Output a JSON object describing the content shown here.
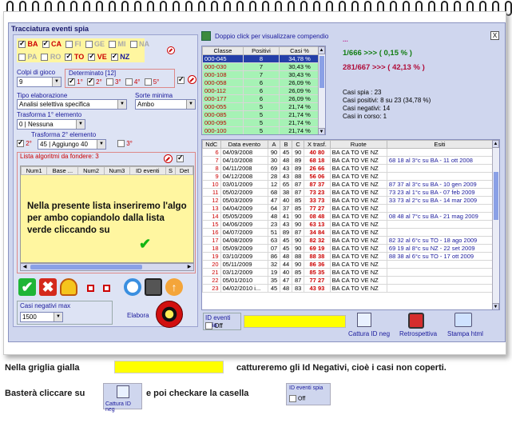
{
  "window_title": "Tracciatura eventi spia",
  "wheels_top": [
    {
      "label": "BA",
      "checked": true,
      "color": "#c00"
    },
    {
      "label": "CA",
      "checked": true,
      "color": "#c00"
    },
    {
      "label": "FI",
      "checked": false,
      "color": "#aaa"
    },
    {
      "label": "GE",
      "checked": false,
      "color": "#aaa"
    },
    {
      "label": "MI",
      "checked": false,
      "color": "#aaa"
    },
    {
      "label": "NA",
      "checked": false,
      "color": "#aaa"
    }
  ],
  "wheels_bottom": [
    {
      "label": "PA",
      "checked": false,
      "color": "#aaa"
    },
    {
      "label": "RO",
      "checked": false,
      "color": "#aaa"
    },
    {
      "label": "TO",
      "checked": true,
      "color": "#c00"
    },
    {
      "label": "VE",
      "checked": true,
      "color": "#c00"
    },
    {
      "label": "NZ",
      "checked": true,
      "color": "#1a1a9c"
    }
  ],
  "colpi_label": "Colpi di gioco",
  "colpi_value": "9",
  "determinato_label": "Determinato [12]",
  "determinato": [
    {
      "label": "1°",
      "checked": true
    },
    {
      "label": "2°",
      "checked": true
    },
    {
      "label": "3°",
      "checked": false
    },
    {
      "label": "4°",
      "checked": false
    },
    {
      "label": "5°",
      "checked": false
    }
  ],
  "tipo_label": "Tipo elaborazione",
  "tipo_value": "Analisi selettiva specifica",
  "sorte_label": "Sorte minima",
  "sorte_value": "Ambo",
  "trasforma1_label": "Trasforma 1° elemento",
  "trasforma1_value": "0 | Nessuna",
  "trasforma2_label": "Trasforma 2° elemento",
  "trasforma2_pos": "2°",
  "trasforma2_value": "45 | Aggiungo 40",
  "trasforma2_pos3": "3°",
  "lista_label": "Lista algoritmi da fondere: 3",
  "lista_columns": [
    "Num1",
    "Base ...",
    "Num2",
    "Num3",
    "ID eventi",
    "S",
    "Det"
  ],
  "overlay_text": "Nella presente lista inseriremo l'algo per ambo copiandolo dalla lista verde cliccando su",
  "casi_neg_label": "Casi negativi max",
  "casi_neg_value": "1500",
  "elabora_label": "Elabora",
  "green_hint": "Doppio click per visualizzare compendio",
  "green_columns": [
    "Classe",
    "Positivi",
    "Casi %"
  ],
  "green_rows": [
    [
      "000-045",
      "8",
      "34,78 %"
    ],
    [
      "000-030",
      "7",
      "30,43 %"
    ],
    [
      "000-108",
      "7",
      "30,43 %"
    ],
    [
      "000-058",
      "6",
      "26,09 %"
    ],
    [
      "000-112",
      "6",
      "26,09 %"
    ],
    [
      "000-177",
      "6",
      "26,09 %"
    ],
    [
      "000-055",
      "5",
      "21,74 %"
    ],
    [
      "000-085",
      "5",
      "21,74 %"
    ],
    [
      "000-095",
      "5",
      "21,74 %"
    ],
    [
      "000-100",
      "5",
      "21,74 %"
    ]
  ],
  "stats": {
    "dots": "...",
    "line1": "1/666 >>> ( 0,15 % )",
    "line2": "281/667 >>> ( 42,13 % )",
    "casi_spia": "Casi spia : 23",
    "casi_positivi": "Casi positivi: 8 su 23 (34,78 %)",
    "casi_negativi": "Casi negativi: 14",
    "casi_in_corso": "Casi in corso: 1"
  },
  "close_label": "X",
  "events_columns": [
    "NdC",
    "Data evento",
    "A",
    "B",
    "C",
    "X trasf.",
    "Ruote",
    "Esiti"
  ],
  "events_rows": [
    [
      "6",
      "04/09/2008",
      "90",
      "45",
      "90",
      "40 80",
      "BA CA TO VE NZ",
      ""
    ],
    [
      "7",
      "04/10/2008",
      "30",
      "48",
      "89",
      "68 18",
      "BA CA TO VE NZ",
      "68 18 al 3°c su BA - 11 ott 2008"
    ],
    [
      "8",
      "04/11/2008",
      "69",
      "43",
      "89",
      "26 66",
      "BA CA TO VE NZ",
      ""
    ],
    [
      "9",
      "04/12/2008",
      "28",
      "43",
      "88",
      "56 06",
      "BA CA TO VE NZ",
      ""
    ],
    [
      "10",
      "03/01/2009",
      "12",
      "65",
      "87",
      "87 37",
      "BA CA TO VE NZ",
      "87 37 al 3°c su BA - 10 gen 2009"
    ],
    [
      "11",
      "05/02/2009",
      "68",
      "38",
      "87",
      "73 23",
      "BA CA TO VE NZ",
      "73 23 al 1°c su BA - 07 feb 2009"
    ],
    [
      "12",
      "05/03/2009",
      "47",
      "40",
      "85",
      "33 73",
      "BA CA TO VE NZ",
      "33 73 al 2°c su BA - 14 mar 2009"
    ],
    [
      "13",
      "04/04/2009",
      "64",
      "37",
      "85",
      "77 27",
      "BA CA TO VE NZ",
      ""
    ],
    [
      "14",
      "05/05/2009",
      "48",
      "41",
      "90",
      "08 48",
      "BA CA TO VE NZ",
      "08 48 al 7°c su BA - 21 mag 2009"
    ],
    [
      "15",
      "04/06/2009",
      "23",
      "43",
      "90",
      "63 13",
      "BA CA TO VE NZ",
      ""
    ],
    [
      "16",
      "04/07/2009",
      "51",
      "89",
      "87",
      "34 84",
      "BA CA TO VE NZ",
      ""
    ],
    [
      "17",
      "04/08/2009",
      "63",
      "45",
      "90",
      "82 32",
      "BA CA TO VE NZ",
      "82 32 al 6°c su TO - 18 ago 2009"
    ],
    [
      "18",
      "05/09/2009",
      "07",
      "45",
      "90",
      "69 19",
      "BA CA TO VE NZ",
      "69 19 al 8°c su NZ - 22 set 2009"
    ],
    [
      "19",
      "03/10/2009",
      "86",
      "48",
      "88",
      "88 38",
      "BA CA TO VE NZ",
      "88 38 al 6°c su TO - 17 ott 2009"
    ],
    [
      "20",
      "05/11/2009",
      "32",
      "44",
      "90",
      "86 36",
      "BA CA TO VE NZ",
      ""
    ],
    [
      "21",
      "03/12/2009",
      "19",
      "40",
      "85",
      "85 35",
      "BA CA TO VE NZ",
      ""
    ],
    [
      "22",
      "05/01/2010",
      "35",
      "47",
      "87",
      "77 27",
      "BA CA TO VE NZ",
      ""
    ],
    [
      "23",
      "04/02/2010 i...",
      "45",
      "48",
      "83",
      "43 93",
      "BA CA TO VE NZ",
      ""
    ]
  ],
  "id_eventi_label": "ID eventi spia",
  "off_label": "Off",
  "cattura_label": "Cattura ID neg",
  "retro_label": "Retrospettiva",
  "stampa_label": "Stampa html",
  "bottom": {
    "line1a": "Nella griglia gialla",
    "line1b": "cattureremo gli Id Negativi, cioè i casi non coperti.",
    "line2a": "Basterà cliccare su",
    "line2b": "e poi checkare la casella",
    "mini_cattura": "Cattura ID neg",
    "mini_id": "ID eventi spia",
    "mini_off": "Off"
  }
}
